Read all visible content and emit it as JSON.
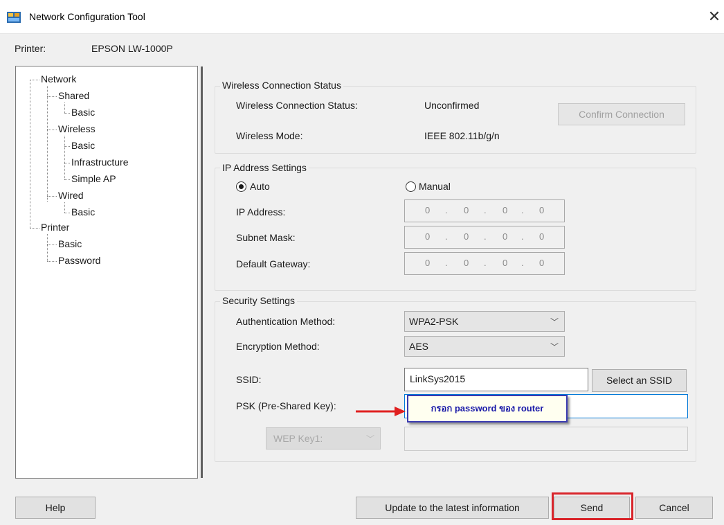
{
  "window": {
    "title": "Network Configuration Tool",
    "close_glyph": "✕"
  },
  "printer": {
    "label": "Printer:",
    "value": "EPSON LW-1000P"
  },
  "tree": {
    "network": "Network",
    "shared": "Shared",
    "shared_basic": "Basic",
    "wireless": "Wireless",
    "wireless_basic": "Basic",
    "infrastructure": "Infrastructure",
    "simple_ap": "Simple AP",
    "wired": "Wired",
    "wired_basic": "Basic",
    "printer": "Printer",
    "printer_basic": "Basic",
    "password": "Password"
  },
  "wireless_status": {
    "group_title": "Wireless Connection Status",
    "status_label": "Wireless Connection Status:",
    "status_value": "Unconfirmed",
    "confirm_button": "Confirm Connection",
    "mode_label": "Wireless Mode:",
    "mode_value": "IEEE 802.11b/g/n"
  },
  "ip_settings": {
    "group_title": "IP Address Settings",
    "auto_label": "Auto",
    "manual_label": "Manual",
    "selected": "Auto",
    "ip_address_label": "IP Address:",
    "subnet_label": "Subnet Mask:",
    "gateway_label": "Default Gateway:",
    "ip_address": [
      "0",
      "0",
      "0",
      "0"
    ],
    "subnet_mask": [
      "0",
      "0",
      "0",
      "0"
    ],
    "gateway": [
      "0",
      "0",
      "0",
      "0"
    ],
    "dot": "."
  },
  "security": {
    "group_title": "Security Settings",
    "auth_label": "Authentication Method:",
    "auth_value": "WPA2-PSK",
    "enc_label": "Encryption Method:",
    "enc_value": "AES",
    "ssid_label": "SSID:",
    "ssid_value": "LinkSys2015",
    "select_ssid_button": "Select an SSID",
    "psk_label": "PSK (Pre-Shared Key):",
    "psk_value": "",
    "wep_key_label": "WEP Key1:",
    "wep_value": ""
  },
  "annotation": {
    "callout_text": "กรอก password ของ router",
    "arrow_color": "#e02020",
    "highlight_color": "#d9252b"
  },
  "footer": {
    "help_button": "Help",
    "update_button": "Update to the latest information",
    "send_button": "Send",
    "cancel_button": "Cancel"
  }
}
